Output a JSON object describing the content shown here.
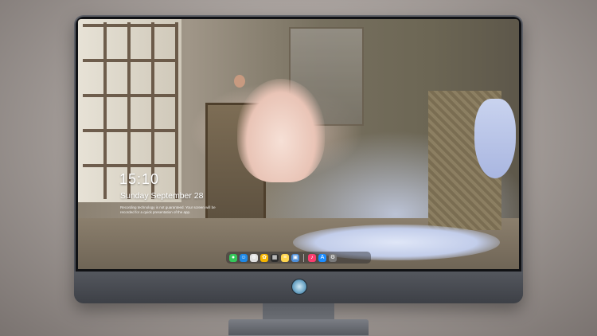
{
  "lock_screen": {
    "time": "15:10",
    "date": "Sunday September 28",
    "note": "Recording technology is not guaranteed. Your screen will be recorded for a quick presentation of the app."
  },
  "dock": {
    "items": [
      {
        "icon": "messages-icon",
        "color": "#34c759",
        "glyph": "●"
      },
      {
        "icon": "finder-icon",
        "color": "#1e88e5",
        "glyph": "☺"
      },
      {
        "icon": "safari-icon",
        "color": "#e0e0e0",
        "glyph": "⊕"
      },
      {
        "icon": "photos-icon",
        "color": "#f5b400",
        "glyph": "✿"
      },
      {
        "icon": "clapper-icon",
        "color": "#2d2d2d",
        "glyph": "▦"
      },
      {
        "icon": "notes-icon",
        "color": "#ffd54f",
        "glyph": "≡"
      },
      {
        "icon": "preview-icon",
        "color": "#4f8fd8",
        "glyph": "▣"
      },
      {
        "icon": "music-icon",
        "color": "#fa3c6e",
        "glyph": "♪"
      },
      {
        "icon": "app-store-icon",
        "color": "#1a8cff",
        "glyph": "A"
      },
      {
        "icon": "settings-icon",
        "color": "#7a7a7a",
        "glyph": "⚙"
      }
    ]
  },
  "colors": {
    "shell": "#4b4e55",
    "bezel": "#101114",
    "background": "#a9a29e"
  }
}
